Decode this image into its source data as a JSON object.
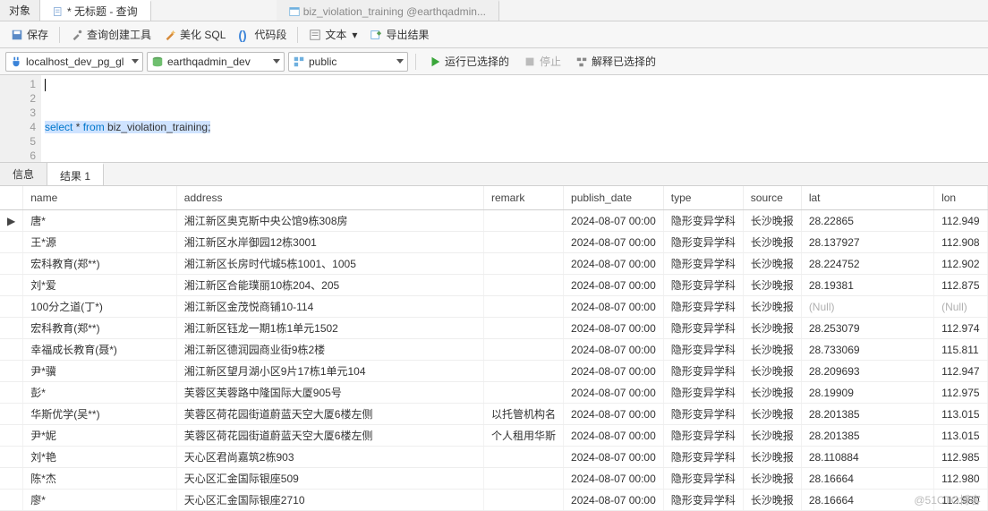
{
  "filetabs": {
    "objects": "对象",
    "query_tab": "* 无标题 - 查询",
    "other_tab": "biz_violation_training @earthqadmin..."
  },
  "toolbar": {
    "save": "保存",
    "query_builder": "查询创建工具",
    "beautify_sql": "美化 SQL",
    "code_snippet": "代码段",
    "text": "文本",
    "export": "导出结果"
  },
  "connbar": {
    "conn": "localhost_dev_pg_gl",
    "db": "earthqadmin_dev",
    "schema": "public",
    "run": "运行已选择的",
    "stop": "停止",
    "explain": "解释已选择的"
  },
  "editor": {
    "lines": [
      "",
      "",
      "",
      "select * from biz_violation_training;",
      "",
      "",
      ""
    ]
  },
  "restabs": {
    "info": "信息",
    "result": "结果 1"
  },
  "columns": {
    "name": "name",
    "address": "address",
    "remark": "remark",
    "publish_date": "publish_date",
    "type": "type",
    "source": "source",
    "lat": "lat",
    "lon": "lon"
  },
  "rows": [
    {
      "marker": "▶",
      "name": "唐*",
      "address": "湘江新区奥克斯中央公馆9栋308房",
      "remark": "",
      "publish_date": "2024-08-07 00:00",
      "type": "隐形变异学科",
      "source": "长沙晚报",
      "lat": "28.22865",
      "lon": "112.949"
    },
    {
      "marker": "",
      "name": "王*源",
      "address": "湘江新区水岸御园12栋3001",
      "remark": "",
      "publish_date": "2024-08-07 00:00",
      "type": "隐形变异学科",
      "source": "长沙晚报",
      "lat": "28.137927",
      "lon": "112.908"
    },
    {
      "marker": "",
      "name": "宏科教育(郑**)",
      "address": "湘江新区长房时代城5栋1001、1005",
      "remark": "",
      "publish_date": "2024-08-07 00:00",
      "type": "隐形变异学科",
      "source": "长沙晚报",
      "lat": "28.224752",
      "lon": "112.902"
    },
    {
      "marker": "",
      "name": "刘*爱",
      "address": "湘江新区合能璞丽10栋204、205",
      "remark": "",
      "publish_date": "2024-08-07 00:00",
      "type": "隐形变异学科",
      "source": "长沙晚报",
      "lat": "28.19381",
      "lon": "112.875"
    },
    {
      "marker": "",
      "name": "100分之道(丁*)",
      "address": "湘江新区金茂悦商铺10-114",
      "remark": "",
      "publish_date": "2024-08-07 00:00",
      "type": "隐形变异学科",
      "source": "长沙晚报",
      "lat": "(Null)",
      "lon": "(Null)",
      "null": true
    },
    {
      "marker": "",
      "name": "宏科教育(郑**)",
      "address": "湘江新区钰龙一期1栋1单元1502",
      "remark": "",
      "publish_date": "2024-08-07 00:00",
      "type": "隐形变异学科",
      "source": "长沙晚报",
      "lat": "28.253079",
      "lon": "112.974"
    },
    {
      "marker": "",
      "name": "幸福成长教育(聂*)",
      "address": "湘江新区德润园商业街9栋2楼",
      "remark": "",
      "publish_date": "2024-08-07 00:00",
      "type": "隐形变异学科",
      "source": "长沙晚报",
      "lat": "28.733069",
      "lon": "115.811"
    },
    {
      "marker": "",
      "name": "尹*骥",
      "address": "湘江新区望月湖小区9片17栋1单元104",
      "remark": "",
      "publish_date": "2024-08-07 00:00",
      "type": "隐形变异学科",
      "source": "长沙晚报",
      "lat": "28.209693",
      "lon": "112.947"
    },
    {
      "marker": "",
      "name": "彭*",
      "address": "芙蓉区芙蓉路中隆国际大厦905号",
      "remark": "",
      "publish_date": "2024-08-07 00:00",
      "type": "隐形变异学科",
      "source": "长沙晚报",
      "lat": "28.19909",
      "lon": "112.975"
    },
    {
      "marker": "",
      "name": "华斯优学(吴**)",
      "address": "芙蓉区荷花园街道蔚蓝天空大厦6楼左侧",
      "remark": "以托管机构名",
      "publish_date": "2024-08-07 00:00",
      "type": "隐形变异学科",
      "source": "长沙晚报",
      "lat": "28.201385",
      "lon": "113.015"
    },
    {
      "marker": "",
      "name": "尹*妮",
      "address": "芙蓉区荷花园街道蔚蓝天空大厦6楼左侧",
      "remark": "个人租用华斯",
      "publish_date": "2024-08-07 00:00",
      "type": "隐形变异学科",
      "source": "长沙晚报",
      "lat": "28.201385",
      "lon": "113.015"
    },
    {
      "marker": "",
      "name": "刘*艳",
      "address": "天心区君尚嘉筑2栋903",
      "remark": "",
      "publish_date": "2024-08-07 00:00",
      "type": "隐形变异学科",
      "source": "长沙晚报",
      "lat": "28.110884",
      "lon": "112.985"
    },
    {
      "marker": "",
      "name": "陈*杰",
      "address": "天心区汇金国际银座509",
      "remark": "",
      "publish_date": "2024-08-07 00:00",
      "type": "隐形变异学科",
      "source": "长沙晚报",
      "lat": "28.16664",
      "lon": "112.980"
    },
    {
      "marker": "",
      "name": "廖*",
      "address": "天心区汇金国际银座2710",
      "remark": "",
      "publish_date": "2024-08-07 00:00",
      "type": "隐形变异学科",
      "source": "长沙晚报",
      "lat": "28.16664",
      "lon": "112.980"
    }
  ],
  "watermark": "@51CTO博客"
}
